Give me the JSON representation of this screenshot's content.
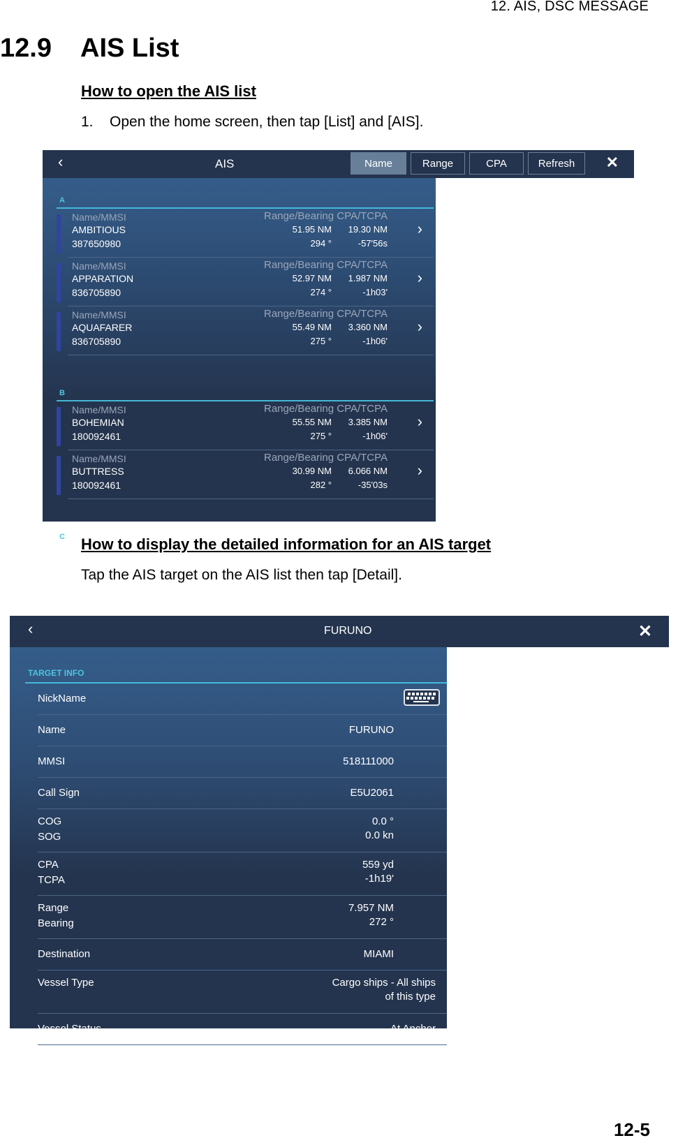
{
  "chapter_header": "12.  AIS, DSC MESSAGE",
  "section": {
    "number": "12.9",
    "title": "AIS List"
  },
  "open_list": {
    "heading": "How to open the AIS list",
    "step_number": "1.",
    "step_text": "Open the home screen, then tap [List] and [AIS]."
  },
  "ais_list": {
    "title": "AIS",
    "back_icon": "chevron-left-icon",
    "close_icon": "close-icon",
    "sort_buttons": [
      {
        "label": "Name",
        "active": true
      },
      {
        "label": "Range",
        "active": false
      },
      {
        "label": "CPA",
        "active": false
      },
      {
        "label": "Refresh",
        "active": false
      }
    ],
    "col_left_label": "Name/MMSI",
    "col_right_label": "Range/Bearing CPA/TCPA",
    "groups": [
      {
        "letter": "A",
        "rows": [
          {
            "name": "AMBITIOUS",
            "mmsi": "387650980",
            "range": "51.95 NM",
            "bearing": "294 °",
            "cpa": "19.30 NM",
            "tcpa": "-57'56s"
          },
          {
            "name": "APPARATION",
            "mmsi": "836705890",
            "range": "52.97 NM",
            "bearing": "274 °",
            "cpa": "1.987 NM",
            "tcpa": "-1h03'"
          },
          {
            "name": "AQUAFARER",
            "mmsi": "836705890",
            "range": "55.49 NM",
            "bearing": "275 °",
            "cpa": "3.360 NM",
            "tcpa": "-1h06'"
          }
        ]
      },
      {
        "letter": "B",
        "rows": [
          {
            "name": "BOHEMIAN",
            "mmsi": "180092461",
            "range": "55.55 NM",
            "bearing": "275 °",
            "cpa": "3.385 NM",
            "tcpa": "-1h06'"
          },
          {
            "name": "BUTTRESS",
            "mmsi": "180092461",
            "range": "30.99 NM",
            "bearing": "282 °",
            "cpa": "6.066 NM",
            "tcpa": "-35'03s"
          }
        ]
      },
      {
        "letter": "C",
        "rows": []
      }
    ]
  },
  "detail_section": {
    "heading": "How to display the detailed information for an AIS target",
    "text": "Tap the AIS target on the AIS list then tap [Detail]."
  },
  "target_info": {
    "title": "FURUNO",
    "section_label": "TARGET INFO",
    "rows": [
      {
        "keys": [
          "NickName"
        ],
        "values": [],
        "keyboard_icon": true
      },
      {
        "keys": [
          "Name"
        ],
        "values": [
          "FURUNO"
        ]
      },
      {
        "keys": [
          "MMSI"
        ],
        "values": [
          "518111000"
        ]
      },
      {
        "keys": [
          "Call Sign"
        ],
        "values": [
          "E5U2061"
        ]
      },
      {
        "keys": [
          "COG",
          "SOG"
        ],
        "values": [
          "0.0 °",
          "0.0 kn"
        ]
      },
      {
        "keys": [
          "CPA",
          "TCPA"
        ],
        "values": [
          "559 yd",
          "-1h19'"
        ]
      },
      {
        "keys": [
          "Range",
          "Bearing"
        ],
        "values": [
          "7.957 NM",
          "272 °"
        ]
      },
      {
        "keys": [
          "Destination"
        ],
        "values": [
          "MIAMI"
        ]
      },
      {
        "keys": [
          "Vessel Type"
        ],
        "values": [
          "Cargo ships - All ships",
          "of this type"
        ],
        "wide": true
      },
      {
        "keys": [
          "Vessel Status"
        ],
        "values": [
          "At Anchor"
        ],
        "wide": true
      }
    ]
  },
  "page_number": "12-5"
}
